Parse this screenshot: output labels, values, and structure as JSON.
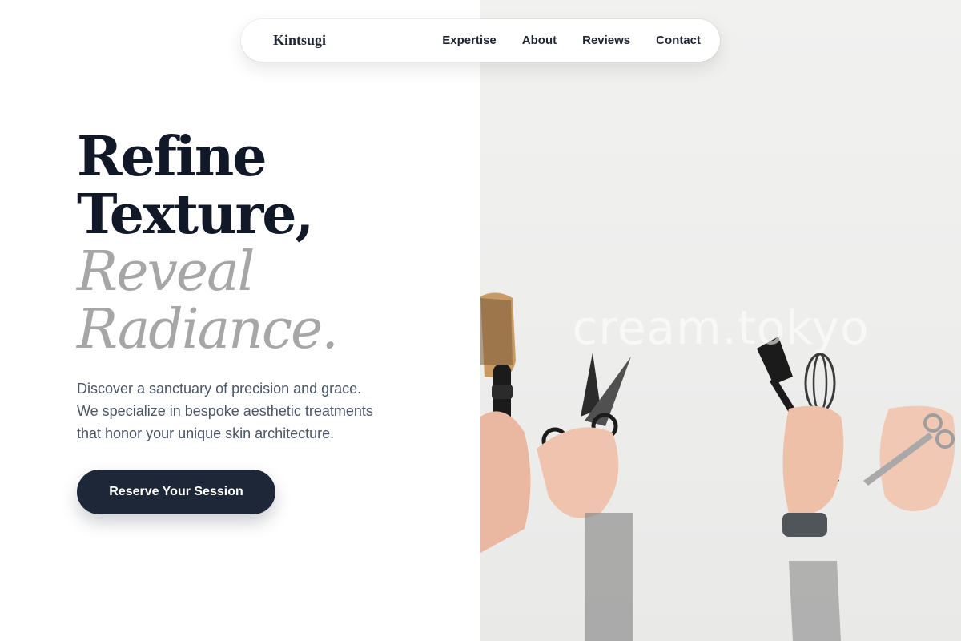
{
  "nav": {
    "brand": "Kintsugi",
    "links": [
      "Expertise",
      "About",
      "Reviews",
      "Contact"
    ]
  },
  "hero": {
    "headline_dark": [
      "Refine",
      "Texture,"
    ],
    "headline_light": [
      "Reveal",
      "Radiance."
    ],
    "intro_lines": [
      "Discover a sanctuary of precision and grace.",
      "We specialize in bespoke aesthetic treatments",
      "that honor your unique skin architecture."
    ],
    "cta_label": "Reserve Your Session"
  },
  "photo": {
    "watermark": "cream.tokyo",
    "icons": [
      "round-brush-icon",
      "scissors-icon",
      "tint-brush-icon",
      "whisk-icon",
      "thinning-shears-icon",
      "smartwatch-icon"
    ]
  },
  "colors": {
    "primary": "#1e2737",
    "headline_dark": "#111827",
    "headline_light": "#a6a6a6",
    "body_text": "#4a5566",
    "background": "#ffffff",
    "photo_bg": "#eeeeed"
  }
}
